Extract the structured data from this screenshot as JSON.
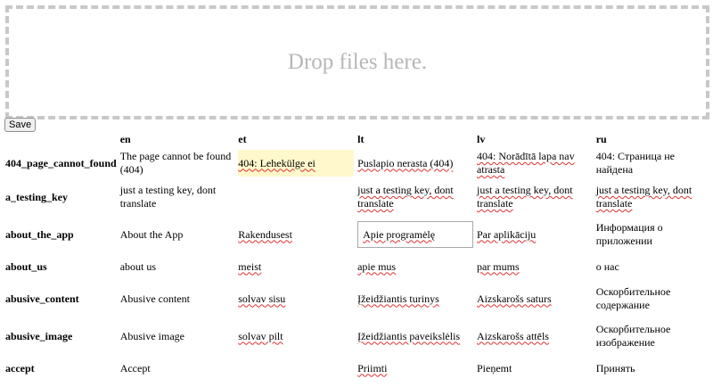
{
  "dropzone": {
    "text": "Drop files here."
  },
  "toolbar": {
    "save_label": "Save"
  },
  "table": {
    "headers": [
      "",
      "en",
      "et",
      "lt",
      "lv",
      "ru"
    ],
    "rows": [
      {
        "key": "404_page_cannot_found",
        "en": "The page cannot be found (404)",
        "et": "404: Lehekülge ei",
        "lt": "Puslapio nerasta (404)",
        "lv": "404: Norādītā lapa nav atrasta",
        "ru": "404: Страница не найдена"
      },
      {
        "key": "a_testing_key",
        "en": "just a testing key, dont translate",
        "et": "",
        "lt": "just a testing key, dont translate",
        "lv": "just a testing key, dont translate",
        "ru": "just a testing key, dont translate"
      },
      {
        "key": "about_the_app",
        "en": "About the App",
        "et": "Rakendusest",
        "lt": "Apie programėlę",
        "lv": "Par aplikāciju",
        "ru": "Информация о приложении"
      },
      {
        "key": "about_us",
        "en": "about us",
        "et": "meist",
        "lt": "apie mus",
        "lv": "par mums",
        "ru": "о нас"
      },
      {
        "key": "abusive_content",
        "en": "Abusive content",
        "et": "solvav sisu",
        "lt": "Įžeidžiantis turinys",
        "lv": "Aizskarošs saturs",
        "ru": "Оскорбительное содержание"
      },
      {
        "key": "abusive_image",
        "en": "Abusive image",
        "et": "solvav pilt",
        "lt": "Įžeidžiantis paveikslėlis",
        "lv": "Aizskarošs attēls",
        "ru": "Оскорбительное изображение"
      },
      {
        "key": "accept",
        "en": "Accept",
        "et": "",
        "lt": "Priimti",
        "lv": "Pieņemt",
        "ru": "Принять"
      }
    ]
  }
}
